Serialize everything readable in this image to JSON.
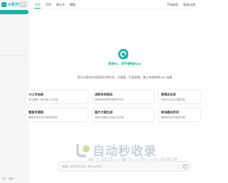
{
  "sidebar": {
    "logo_text": "AI写作",
    "logo_badge": "Pro",
    "footer_items": [
      "会员",
      "设置"
    ]
  },
  "topnav": {
    "items": [
      "创作",
      "写作",
      "新工作",
      "模板"
    ],
    "right_items": [
      "手机体验",
      "登录/注册"
    ]
  },
  "hero": {
    "slogan": "有你AI，写作更加Easy",
    "desc": "我可以帮你在网页的任何时间，写周报、写演讲稿、做工作规划等200+场景"
  },
  "cards": [
    {
      "title": "AI工作总结",
      "desc": "自动整理一周/月度工作内容"
    },
    {
      "title": "述职年终报告",
      "desc": "快速完成述职年终报告写作"
    },
    {
      "title": "我是会议员",
      "desc": "快速生成会议纪要内容"
    },
    {
      "title": "智能写周报",
      "desc": "根据本周内容生成精致周报"
    },
    {
      "title": "图片文案生成",
      "desc": "智能识别图片内容生成文案"
    },
    {
      "title": "职场趣向百问",
      "desc": "解答职场中的各类问题"
    }
  ],
  "chat": {
    "placeholder": "请输入你想写的内容，按Enter发送"
  },
  "watermark": {
    "title": "自动秒收录",
    "subtitle": "做上链接一来访一次一自动收录"
  },
  "colors": {
    "accent": "#19b3a8",
    "sidebar_bg": "#f5f6f8"
  }
}
